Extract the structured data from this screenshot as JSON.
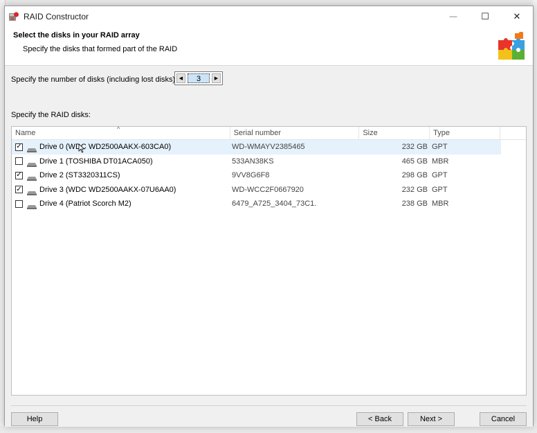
{
  "window": {
    "title": "RAID Constructor",
    "minimize_glyph": "—",
    "maximize_glyph": "☐",
    "close_glyph": "✕"
  },
  "header": {
    "title": "Select the disks in your RAID array",
    "subtitle": "Specify the disks that formed part of the RAID",
    "icon": "puzzle-icon"
  },
  "disk_count": {
    "label": "Specify the number of disks (including lost disks):",
    "value": "3"
  },
  "raid_disks": {
    "label": "Specify the RAID disks:",
    "columns": [
      "Name",
      "Serial number",
      "Size",
      "Type"
    ],
    "rows": [
      {
        "checked": true,
        "name": "Drive 0 (WDC WD2500AAKX-603CA0)",
        "serial": "WD-WMAYV2385465",
        "size": "232 GB",
        "type": "GPT",
        "selected": true
      },
      {
        "checked": false,
        "name": "Drive 1 (TOSHIBA DT01ACA050)",
        "serial": "533AN38KS",
        "size": "465 GB",
        "type": "MBR",
        "selected": false
      },
      {
        "checked": true,
        "name": "Drive 2 (ST3320311CS)",
        "serial": "9VV8G6F8",
        "size": "298 GB",
        "type": "GPT",
        "selected": false
      },
      {
        "checked": true,
        "name": "Drive 3 (WDC WD2500AAKX-07U6AA0)",
        "serial": "WD-WCC2F0667920",
        "size": "232 GB",
        "type": "GPT",
        "selected": false
      },
      {
        "checked": false,
        "name": "Drive 4 (Patriot Scorch M2)",
        "serial": "6479_A725_3404_73C1.",
        "size": "238 GB",
        "type": "MBR",
        "selected": false
      }
    ]
  },
  "footer": {
    "help": "Help",
    "back": "< Back",
    "next": "Next >",
    "cancel": "Cancel"
  },
  "colors": {
    "selection": "#e5f1fb",
    "panel": "#f0f0f0",
    "button": "#e1e1e1"
  }
}
